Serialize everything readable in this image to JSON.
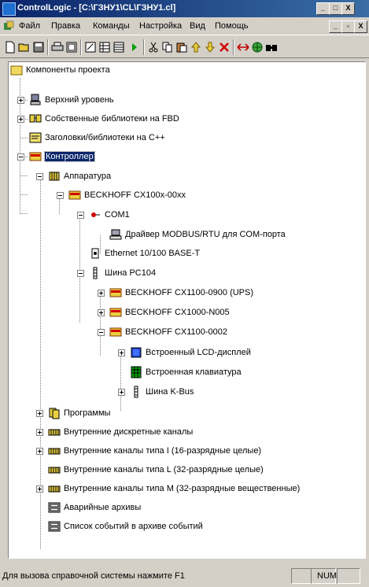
{
  "window": {
    "title": "ControlLogic - [C:\\ГЗНУ1\\CL\\ГЗНУ1.cl]",
    "controls": [
      "_",
      "□",
      "X"
    ],
    "child_controls": [
      "_",
      "▫",
      "X"
    ]
  },
  "menu": [
    "Файл",
    "Правка",
    "Команды",
    "Настройка",
    "Вид",
    "Помощь"
  ],
  "toolbar": {
    "icons": [
      "new-file-icon",
      "open-folder-icon",
      "save-icon",
      "print-icon",
      "view-icon",
      "properties-icon",
      "grid-icon",
      "table-icon",
      "run-icon",
      "cut-icon",
      "copy-icon",
      "paste-icon",
      "move-up-icon",
      "move-down-icon",
      "delete-icon",
      "link-icon",
      "globe-icon",
      "find-icon"
    ]
  },
  "tree": [
    {
      "label": "Компоненты проекта",
      "icon": "folder-icon"
    },
    {
      "label": "Верхний уровень",
      "icon": "computer-icon"
    },
    {
      "label": "Собственные библиотеки на FBD",
      "icon": "fbd-library-icon"
    },
    {
      "label": "Заголовки/библиотеки на C++",
      "icon": "header-icon"
    },
    {
      "label": "Контроллер",
      "icon": "controller-icon",
      "selected": true
    },
    {
      "label": "Аппаратура",
      "icon": "hardware-icon"
    },
    {
      "label": "BECKHOFF CX100x-00xx",
      "icon": "device-icon"
    },
    {
      "label": "COM1",
      "icon": "com-port-icon"
    },
    {
      "label": "Драйвер MODBUS/RTU для COM-порта",
      "icon": "driver-icon"
    },
    {
      "label": "Ethernet 10/100 BASE-T",
      "icon": "ethernet-icon"
    },
    {
      "label": "Шина PC104",
      "icon": "bus-icon"
    },
    {
      "label": "BECKHOFF CX1100-0900 (UPS)",
      "icon": "device-icon"
    },
    {
      "label": "BECKHOFF CX1000-N005",
      "icon": "device-icon"
    },
    {
      "label": "BECKHOFF CX1100-0002",
      "icon": "device-icon"
    },
    {
      "label": "Встроенный LCD-дисплей",
      "icon": "lcd-display-icon"
    },
    {
      "label": "Встроенная клавиатура",
      "icon": "keyboard-icon"
    },
    {
      "label": "Шина K-Bus",
      "icon": "bus-icon"
    },
    {
      "label": "Программы",
      "icon": "programs-icon"
    },
    {
      "label": "Внутренние дискретные каналы",
      "icon": "channel-icon"
    },
    {
      "label": "Внутренние каналы типа I (16-разрядные целые)",
      "icon": "channel-icon"
    },
    {
      "label": "Внутренние каналы типа L (32-разрядные целые)",
      "icon": "channel-icon"
    },
    {
      "label": "Внутренние каналы типа М (32-разрядные вещественные)",
      "icon": "channel-icon"
    },
    {
      "label": "Аварийные архивы",
      "icon": "archive-icon"
    },
    {
      "label": "Список событий в архиве событий",
      "icon": "archive-icon"
    }
  ],
  "status": {
    "text": "Для вызова справочной системы нажмите F1",
    "num": "NUM"
  },
  "colors": {
    "titlebar": "#0a246a",
    "selection": "#0a246a",
    "chrome": "#d4d0c8"
  }
}
